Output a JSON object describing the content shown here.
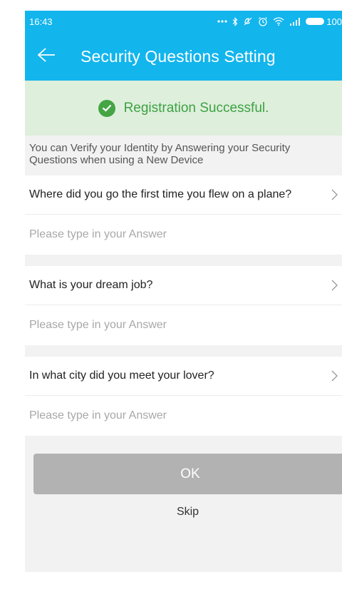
{
  "status_bar": {
    "time": "16:43",
    "battery_text": "100",
    "icons": [
      "more-dots-icon",
      "bluetooth-icon",
      "no-disturb-icon",
      "alarm-icon",
      "wifi-icon",
      "signal-icon",
      "battery-icon"
    ]
  },
  "app_bar": {
    "title": "Security Questions Setting",
    "back_icon": "back-arrow-icon"
  },
  "banner": {
    "icon": "check-circle-icon",
    "text": "Registration Successful."
  },
  "info": {
    "text": "You can Verify your Identity by Answering your Security\nQuestions when using a New Device"
  },
  "questions": [
    {
      "question": "Where did you go the first time you flew on a plane?",
      "placeholder": "Please type in your Answer",
      "answer": ""
    },
    {
      "question": "What is your dream job?",
      "placeholder": "Please type in your Answer",
      "answer": ""
    },
    {
      "question": "In what city did you meet your lover?",
      "placeholder": "Please type in your Answer",
      "answer": ""
    }
  ],
  "actions": {
    "ok_label": "OK",
    "skip_label": "Skip"
  },
  "colors": {
    "header": "#12b5ec",
    "banner_bg": "#deefdc",
    "banner_text": "#3ea143",
    "button_disabled": "#b2b2b2"
  }
}
